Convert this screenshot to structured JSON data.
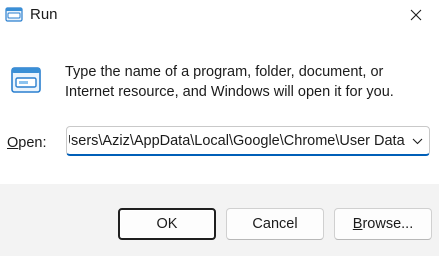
{
  "window": {
    "title": "Run",
    "close_icon": "close-icon",
    "app_icon": "run-dialog-icon"
  },
  "description": {
    "line1": "Type the name of a program, folder, document, or",
    "line2": "Internet resource, and Windows will open it for you."
  },
  "open_field": {
    "label_accel": "O",
    "label_rest": "pen:",
    "value": "C:\\Users\\Aziz\\AppData\\Local\\Google\\Chrome\\User Data",
    "dropdown_icon": "chevron-down-icon"
  },
  "buttons": {
    "ok_label": "OK",
    "cancel_label": "Cancel",
    "browse_accel": "B",
    "browse_rest": "rowse..."
  },
  "colors": {
    "accent": "#005fb8",
    "icon_blue": "#3a8fd6"
  }
}
